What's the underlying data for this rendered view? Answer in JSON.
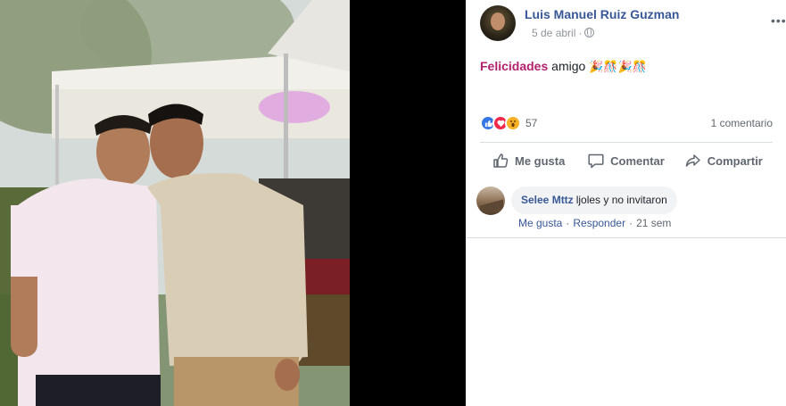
{
  "post": {
    "author": "Luis Manuel Ruiz Guzman",
    "date": "5 de abril",
    "meta_separator": "·",
    "more_label": "•••",
    "text_tag": "Felicidades",
    "text_body": " amigo ",
    "text_emojis": "🎉🎊🎉🎊"
  },
  "reactions": {
    "count": "57",
    "comments_count": "1 comentario",
    "types": [
      "like-icon",
      "love-icon",
      "wow-icon"
    ]
  },
  "actions": {
    "like_label": "Me gusta",
    "comment_label": "Comentar",
    "share_label": "Compartir"
  },
  "comment": {
    "name": "Selee Mttz",
    "text": "ljoles y no invitaron",
    "like_label": "Me gusta",
    "reply_label": "Responder",
    "time": "21 sem",
    "separator": "·"
  },
  "colors": {
    "link": "#385898",
    "tag": "#b2226f",
    "muted": "#606770"
  }
}
